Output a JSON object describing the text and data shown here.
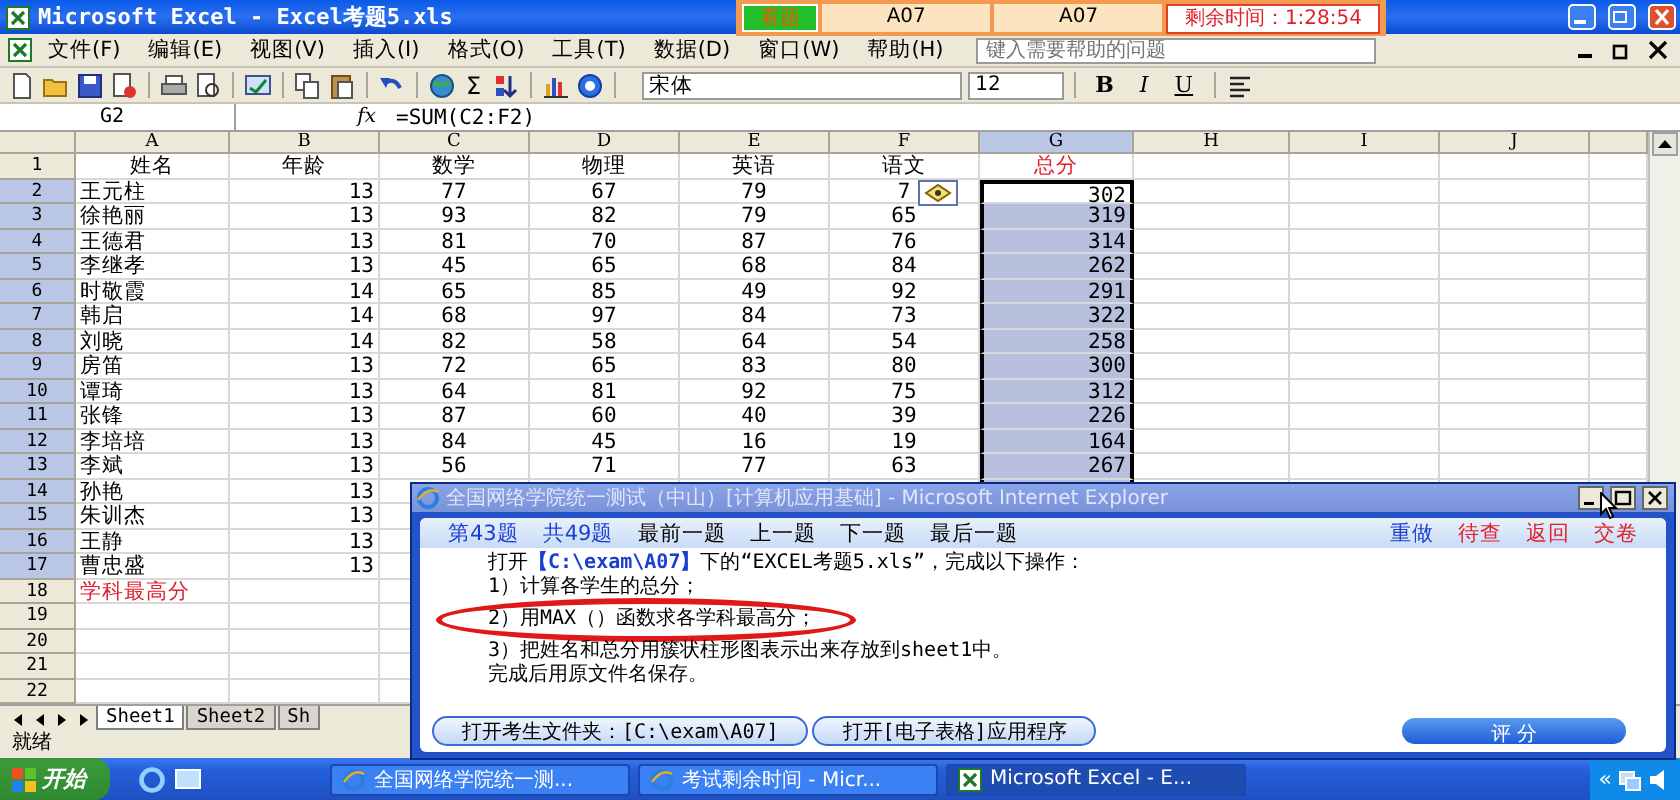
{
  "window": {
    "title": "Microsoft Excel - Excel考题5.xls"
  },
  "exam_bar": {
    "view_button": "看题",
    "fields": [
      "A07",
      "A07"
    ],
    "timer": "剩余时间：1:28:54"
  },
  "menu": [
    "文件(F)",
    "编辑(E)",
    "视图(V)",
    "插入(I)",
    "格式(O)",
    "工具(T)",
    "数据(D)",
    "窗口(W)",
    "帮助(H)"
  ],
  "help_box": {
    "placeholder": "键入需要帮助的问题"
  },
  "toolbar": {
    "sum": "Σ",
    "font": "宋体",
    "size": "12",
    "bold": "B",
    "italic": "I",
    "underline": "U"
  },
  "formula_bar": {
    "name_box": "G2",
    "fx": "fx",
    "formula": "=SUM(C2:F2)"
  },
  "sheet": {
    "columns": [
      "A",
      "B",
      "C",
      "D",
      "E",
      "F",
      "G",
      "H",
      "I",
      "J"
    ],
    "rows": [
      {
        "number": "1",
        "kind": "header",
        "cells": [
          "姓名",
          "年龄",
          "数学",
          "物理",
          "英语",
          "语文",
          "总分"
        ],
        "selected": false,
        "active": false,
        "smart_tag": false
      },
      {
        "number": "2",
        "kind": "data",
        "cells": [
          "王元柱",
          "13",
          "77",
          "67",
          "79",
          "7",
          "302"
        ],
        "selected": true,
        "active": true,
        "smart_tag": true
      },
      {
        "number": "3",
        "kind": "data",
        "cells": [
          "徐艳丽",
          "13",
          "93",
          "82",
          "79",
          "65",
          "319"
        ],
        "selected": true,
        "active": false,
        "smart_tag": false
      },
      {
        "number": "4",
        "kind": "data",
        "cells": [
          "王德君",
          "13",
          "81",
          "70",
          "87",
          "76",
          "314"
        ],
        "selected": true,
        "active": false,
        "smart_tag": false
      },
      {
        "number": "5",
        "kind": "data",
        "cells": [
          "李继孝",
          "13",
          "45",
          "65",
          "68",
          "84",
          "262"
        ],
        "selected": true,
        "active": false,
        "smart_tag": false
      },
      {
        "number": "6",
        "kind": "data",
        "cells": [
          "时敬霞",
          "14",
          "65",
          "85",
          "49",
          "92",
          "291"
        ],
        "selected": true,
        "active": false,
        "smart_tag": false
      },
      {
        "number": "7",
        "kind": "data",
        "cells": [
          "韩启",
          "14",
          "68",
          "97",
          "84",
          "73",
          "322"
        ],
        "selected": true,
        "active": false,
        "smart_tag": false
      },
      {
        "number": "8",
        "kind": "data",
        "cells": [
          "刘晓",
          "14",
          "82",
          "58",
          "64",
          "54",
          "258"
        ],
        "selected": true,
        "active": false,
        "smart_tag": false
      },
      {
        "number": "9",
        "kind": "data",
        "cells": [
          "房笛",
          "13",
          "72",
          "65",
          "83",
          "80",
          "300"
        ],
        "selected": true,
        "active": false,
        "smart_tag": false
      },
      {
        "number": "10",
        "kind": "data",
        "cells": [
          "谭琦",
          "13",
          "64",
          "81",
          "92",
          "75",
          "312"
        ],
        "selected": true,
        "active": false,
        "smart_tag": false
      },
      {
        "number": "11",
        "kind": "data",
        "cells": [
          "张锋",
          "13",
          "87",
          "60",
          "40",
          "39",
          "226"
        ],
        "selected": true,
        "active": false,
        "smart_tag": false
      },
      {
        "number": "12",
        "kind": "data",
        "cells": [
          "李培培",
          "13",
          "84",
          "45",
          "16",
          "19",
          "164"
        ],
        "selected": true,
        "active": false,
        "smart_tag": false
      },
      {
        "number": "13",
        "kind": "data",
        "cells": [
          "李斌",
          "13",
          "56",
          "71",
          "77",
          "63",
          "267"
        ],
        "selected": true,
        "active": false,
        "smart_tag": false
      },
      {
        "number": "14",
        "kind": "data",
        "cells": [
          "孙艳",
          "13"
        ],
        "selected": true,
        "active": false,
        "smart_tag": false
      },
      {
        "number": "15",
        "kind": "data",
        "cells": [
          "朱训杰",
          "13"
        ],
        "selected": true,
        "active": false,
        "smart_tag": false
      },
      {
        "number": "16",
        "kind": "data",
        "cells": [
          "王静",
          "13"
        ],
        "selected": true,
        "active": false,
        "smart_tag": false
      },
      {
        "number": "17",
        "kind": "data",
        "cells": [
          "曹忠盛",
          "13"
        ],
        "selected": true,
        "active": false,
        "smart_tag": false
      },
      {
        "number": "18",
        "kind": "summary",
        "cells": [
          "学科最高分"
        ],
        "selected": false,
        "active": false,
        "smart_tag": false
      },
      {
        "number": "19",
        "kind": "data",
        "cells": [],
        "selected": false,
        "active": false,
        "smart_tag": false
      },
      {
        "number": "20",
        "kind": "data",
        "cells": [],
        "selected": false,
        "active": false,
        "smart_tag": false
      },
      {
        "number": "21",
        "kind": "data",
        "cells": [],
        "selected": false,
        "active": false,
        "smart_tag": false
      },
      {
        "number": "22",
        "kind": "data",
        "cells": [],
        "selected": false,
        "active": false,
        "smart_tag": false
      }
    ]
  },
  "sheet_tabs": [
    {
      "label": "Sheet1",
      "selected": true
    },
    {
      "label": "Sheet2",
      "selected": false
    },
    {
      "label": "Sh",
      "selected": false
    }
  ],
  "status_bar": {
    "text": "就绪"
  },
  "exam_window": {
    "title": "全国网络学院统一测试（中山）[计算机应用基础] - Microsoft Internet Explorer",
    "nav": [
      {
        "label": "第43题",
        "color": "#1a3fd0"
      },
      {
        "label": "共49题",
        "color": "#1a3fd0"
      },
      {
        "label": "最前一题",
        "color": "#000000"
      },
      {
        "label": "上一题",
        "color": "#000000"
      },
      {
        "label": "下一题",
        "color": "#000000"
      },
      {
        "label": "最后一题",
        "color": "#000000"
      },
      {
        "label": "重做",
        "color": "#1a3fd0"
      },
      {
        "label": "待查",
        "color": "#e0202a"
      },
      {
        "label": "返回",
        "color": "#e0202a"
      },
      {
        "label": "交卷",
        "color": "#e0202a"
      }
    ],
    "lines": [
      {
        "text": "打开**【C:\\exam\\A07】**下的“EXCEL考题5.xls”，完成以下操作：",
        "circled": false
      },
      {
        "text": "1）计算各学生的总分；",
        "circled": false
      },
      {
        "text": "2）用MAX（）函数求各学科最高分；",
        "circled": true
      },
      {
        "text": "3）把姓名和总分用簇状柱形图表示出来存放到sheet1中。",
        "circled": false
      },
      {
        "text": "完成后用原文件名保存。",
        "circled": false
      }
    ],
    "buttons": [
      "打开考生文件夹：[C:\\exam\\A07]",
      "打开[电子表格]应用程序"
    ],
    "grade_button": "评 分"
  },
  "taskbar": {
    "start": "开始",
    "tasks": [
      {
        "label": "全国网络学院统一测...",
        "kind": "ie",
        "selected": false
      },
      {
        "label": "考试剩余时间 - Micr...",
        "kind": "ie",
        "selected": false
      },
      {
        "label": "Microsoft Excel - E...",
        "kind": "excel",
        "selected": true
      }
    ],
    "tray_toggle": "«"
  }
}
